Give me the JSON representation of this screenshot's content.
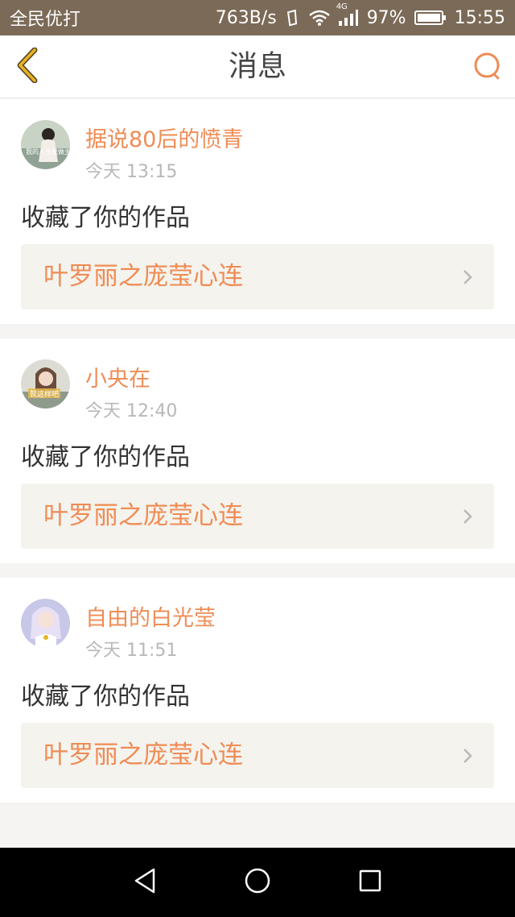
{
  "status_bar": {
    "app_name": "全民优打",
    "network_speed": "763B/s",
    "signal_type": "4G",
    "battery": "97%",
    "time": "15:55"
  },
  "header": {
    "title": "消息",
    "back_icon": "chevron-left-icon",
    "search_icon": "search-icon"
  },
  "colors": {
    "accent": "#ef8c55",
    "icon_yellow": "#e8b422",
    "status_bar_bg": "#7b6a57"
  },
  "messages": [
    {
      "username": "据说80后的愤青",
      "time": "今天 13:15",
      "action": "收藏了你的作品",
      "work_title": "叶罗丽之庞莹心连",
      "avatar_text": "我的人生我做主"
    },
    {
      "username": "小央在",
      "time": "今天 12:40",
      "action": "收藏了你的作品",
      "work_title": "叶罗丽之庞莹心连",
      "avatar_text": "就这样吧"
    },
    {
      "username": "自由的白光莹",
      "time": "今天 11:51",
      "action": "收藏了你的作品",
      "work_title": "叶罗丽之庞莹心连",
      "avatar_text": ""
    }
  ],
  "nav_buttons": {
    "back": "triangle-back-icon",
    "home": "circle-home-icon",
    "recents": "square-recents-icon"
  }
}
